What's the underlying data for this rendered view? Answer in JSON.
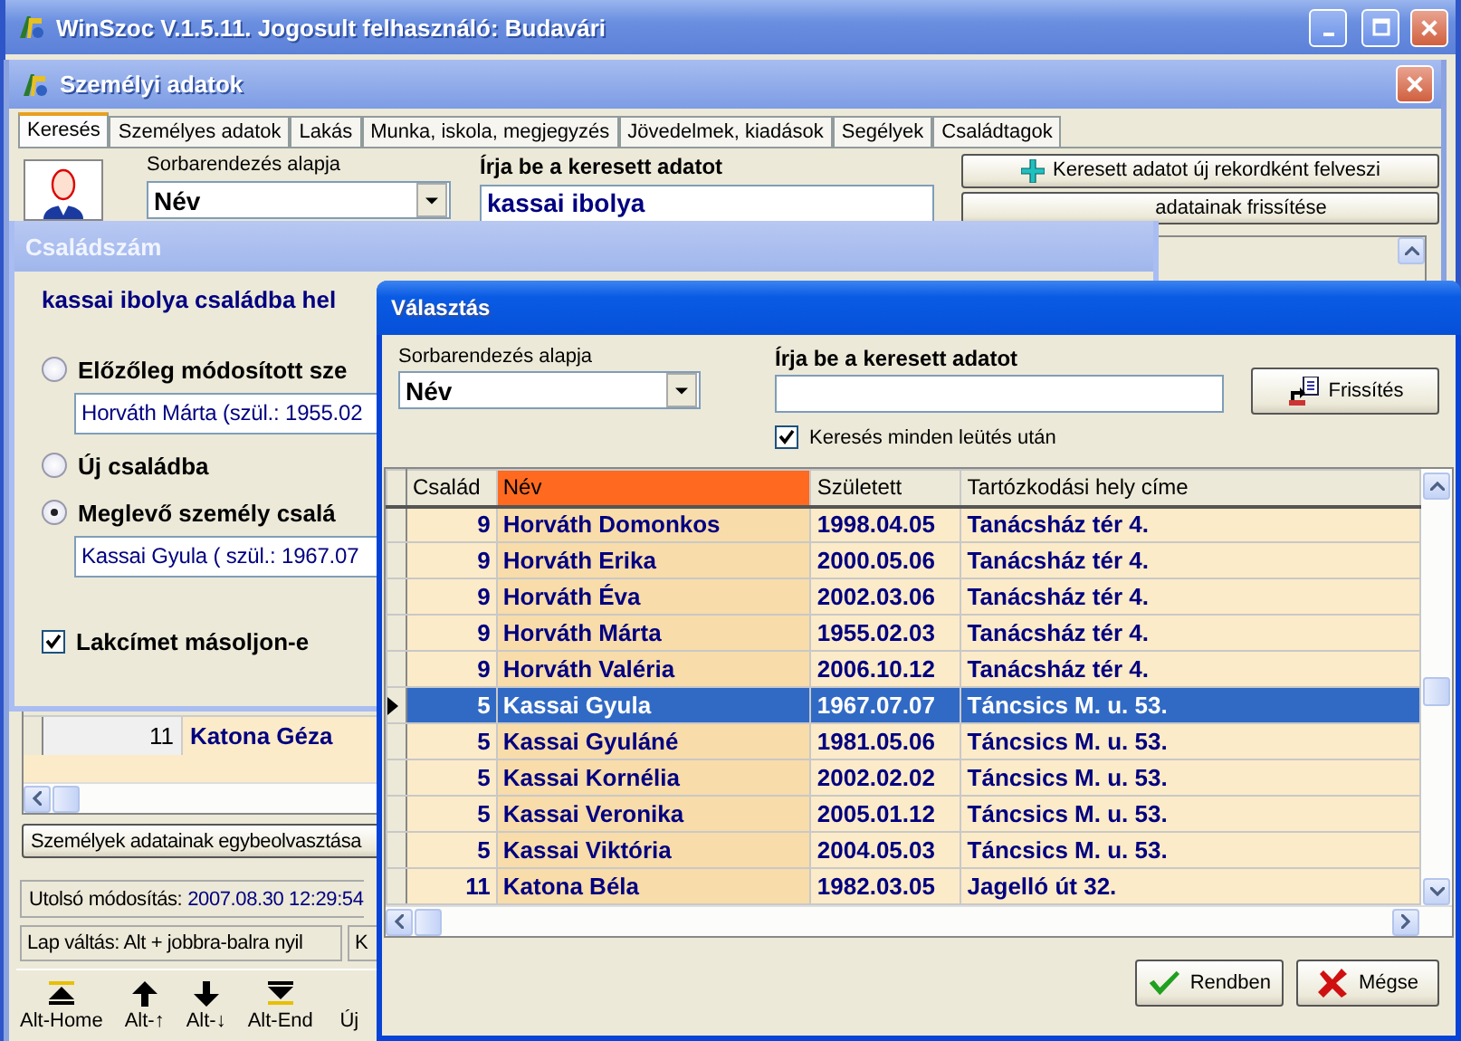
{
  "main_window": {
    "title": "WinSzoc V.1.5.11.  Jogosult felhasználó: Budavári"
  },
  "person_window": {
    "title": "Személyi adatok",
    "tabs": [
      {
        "label": "Keresés",
        "selected": true
      },
      {
        "label": "Személyes adatok",
        "selected": false
      },
      {
        "label": "Lakás",
        "selected": false
      },
      {
        "label": "Munka, iskola, megjegyzés",
        "selected": false
      },
      {
        "label": "Jövedelmek, kiadások",
        "selected": false
      },
      {
        "label": "Segélyek",
        "selected": false
      },
      {
        "label": "Családtagok",
        "selected": false
      }
    ],
    "sort_label": "Sorbarendezés alapja",
    "sort_value": "Név",
    "search_label": "Írja be a keresett adatot",
    "search_value": "kassai ibolya",
    "add_button": "Keresett adatot új rekordként felveszi",
    "refresh_button": "adatainak frissítése",
    "rows": [
      {
        "family": "11",
        "name": "Katona Géza"
      }
    ],
    "merge_button": "Személyek adatainak egybeolvasztása",
    "last_modified_label": "Utolsó módosítás:",
    "last_modified_value": "2007.08.30 12:29:54",
    "status": "Lap váltás: Alt + jobbra-balra nyil",
    "status_2": "K",
    "nav_buttons": [
      {
        "label": "Alt-Home",
        "kind": "first"
      },
      {
        "label": "Alt-↑",
        "kind": "up"
      },
      {
        "label": "Alt-↓",
        "kind": "down"
      },
      {
        "label": "Alt-End",
        "kind": "last"
      },
      {
        "label": "Új",
        "kind": "new"
      }
    ]
  },
  "family_dialog": {
    "title": "Családszám",
    "heading": "kassai ibolya családba hel",
    "options": [
      {
        "label": "Előzőleg módosított sze",
        "selected": false,
        "detail": "Horváth Márta (szül.: 1955.02"
      },
      {
        "label": "Új családba",
        "selected": false
      },
      {
        "label": "Meglevő személy csalá",
        "selected": true,
        "detail": "Kassai Gyula ( szül.: 1967.07"
      }
    ],
    "copy_address": {
      "label": "Lakcímet másoljon-e",
      "checked": true
    }
  },
  "choose_dialog": {
    "title": "Választás",
    "sort_label": "Sorbarendezés alapja",
    "sort_value": "Név",
    "search_label": "Írja be a keresett adatot",
    "refresh_button": "Frissítés",
    "search_each_key": {
      "label": "Keresés minden leütés után",
      "checked": true
    },
    "columns": [
      {
        "label": "Család",
        "selected": false
      },
      {
        "label": "Név",
        "selected": true
      },
      {
        "label": "Született",
        "selected": false
      },
      {
        "label": "Tartózkodási hely címe",
        "selected": false
      }
    ],
    "rows": [
      {
        "family": "9",
        "name": "Horváth Domonkos",
        "born": "1998.04.05",
        "address": "Tanácsház tér 4.",
        "selected": false
      },
      {
        "family": "9",
        "name": "Horváth Erika",
        "born": "2000.05.06",
        "address": "Tanácsház tér 4.",
        "selected": false
      },
      {
        "family": "9",
        "name": "Horváth Éva",
        "born": "2002.03.06",
        "address": "Tanácsház tér 4.",
        "selected": false
      },
      {
        "family": "9",
        "name": "Horváth Márta",
        "born": "1955.02.03",
        "address": "Tanácsház tér 4.",
        "selected": false
      },
      {
        "family": "9",
        "name": "Horváth Valéria",
        "born": "2006.10.12",
        "address": "Tanácsház tér 4.",
        "selected": false
      },
      {
        "family": "5",
        "name": "Kassai Gyula",
        "born": "1967.07.07",
        "address": "Táncsics M. u. 53.",
        "selected": true
      },
      {
        "family": "5",
        "name": "Kassai Gyuláné",
        "born": "1981.05.06",
        "address": "Táncsics M. u. 53.",
        "selected": false
      },
      {
        "family": "5",
        "name": "Kassai Kornélia",
        "born": "2002.02.02",
        "address": "Táncsics M. u. 53.",
        "selected": false
      },
      {
        "family": "5",
        "name": "Kassai Veronika",
        "born": "2005.01.12",
        "address": "Táncsics M. u. 53.",
        "selected": false
      },
      {
        "family": "5",
        "name": "Kassai Viktória",
        "born": "2004.05.03",
        "address": "Táncsics M. u. 53.",
        "selected": false
      },
      {
        "family": "11",
        "name": "Katona Béla",
        "born": "1982.03.05",
        "address": "Jagelló út 32.",
        "selected": false
      }
    ],
    "ok_button": "Rendben",
    "cancel_button": "Mégse"
  }
}
